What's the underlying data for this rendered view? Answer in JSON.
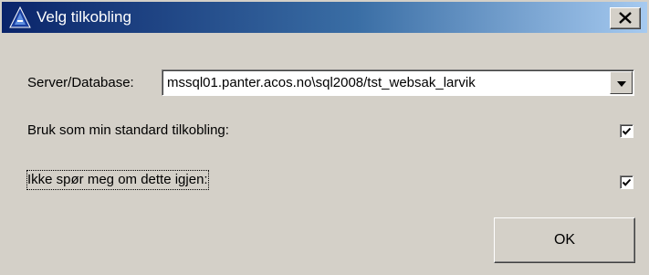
{
  "window": {
    "title": "Velg tilkobling",
    "close_label": "✕"
  },
  "server": {
    "label": "Server/Database:",
    "value": "mssql01.panter.acos.no\\sql2008/tst_websak_larvik"
  },
  "options": {
    "standard_label": "Bruk som min standard tilkobling:",
    "standard_checked": true,
    "dontask_label": "Ikke spør meg om dette igjen:",
    "dontask_checked": true
  },
  "buttons": {
    "ok_label": "OK"
  },
  "colors": {
    "titlebar_start": "#0a246a",
    "titlebar_end": "#a6caf0",
    "face": "#d4d0c8"
  }
}
